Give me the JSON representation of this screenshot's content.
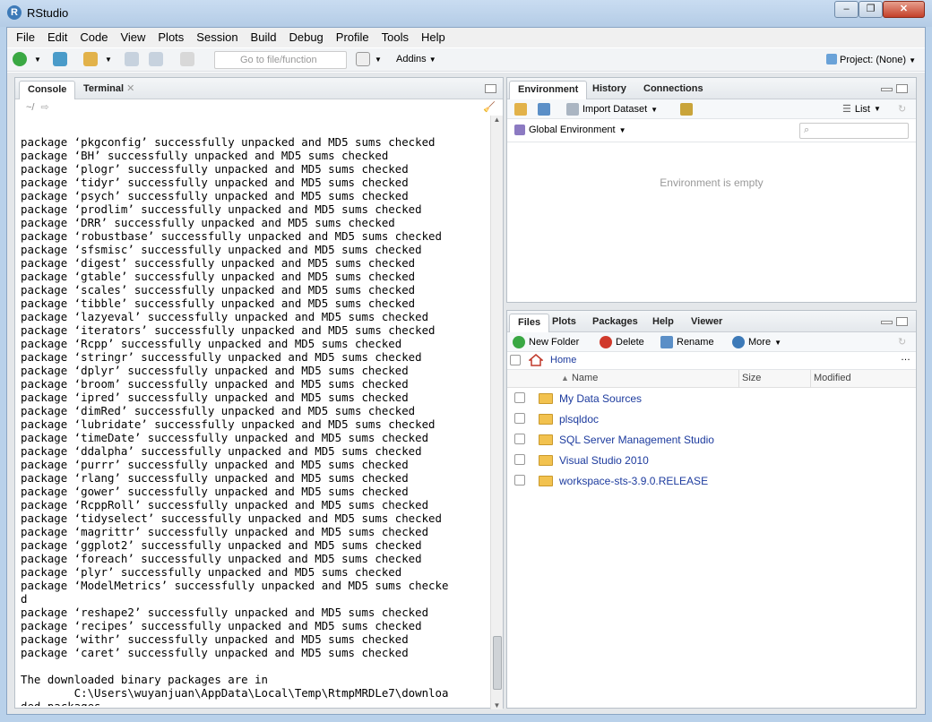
{
  "window": {
    "title": "RStudio"
  },
  "menu": [
    "File",
    "Edit",
    "Code",
    "View",
    "Plots",
    "Session",
    "Build",
    "Debug",
    "Profile",
    "Tools",
    "Help"
  ],
  "toolbar": {
    "goto_placeholder": "Go to file/function",
    "addins_label": "Addins",
    "project_label": "Project: (None)"
  },
  "console_pane": {
    "tabs": [
      "Console",
      "Terminal"
    ],
    "path": "~/",
    "lines": [
      "package ‘pkgconfig’ successfully unpacked and MD5 sums checked",
      "package ‘BH’ successfully unpacked and MD5 sums checked",
      "package ‘plogr’ successfully unpacked and MD5 sums checked",
      "package ‘tidyr’ successfully unpacked and MD5 sums checked",
      "package ‘psych’ successfully unpacked and MD5 sums checked",
      "package ‘prodlim’ successfully unpacked and MD5 sums checked",
      "package ‘DRR’ successfully unpacked and MD5 sums checked",
      "package ‘robustbase’ successfully unpacked and MD5 sums checked",
      "package ‘sfsmisc’ successfully unpacked and MD5 sums checked",
      "package ‘digest’ successfully unpacked and MD5 sums checked",
      "package ‘gtable’ successfully unpacked and MD5 sums checked",
      "package ‘scales’ successfully unpacked and MD5 sums checked",
      "package ‘tibble’ successfully unpacked and MD5 sums checked",
      "package ‘lazyeval’ successfully unpacked and MD5 sums checked",
      "package ‘iterators’ successfully unpacked and MD5 sums checked",
      "package ‘Rcpp’ successfully unpacked and MD5 sums checked",
      "package ‘stringr’ successfully unpacked and MD5 sums checked",
      "package ‘dplyr’ successfully unpacked and MD5 sums checked",
      "package ‘broom’ successfully unpacked and MD5 sums checked",
      "package ‘ipred’ successfully unpacked and MD5 sums checked",
      "package ‘dimRed’ successfully unpacked and MD5 sums checked",
      "package ‘lubridate’ successfully unpacked and MD5 sums checked",
      "package ‘timeDate’ successfully unpacked and MD5 sums checked",
      "package ‘ddalpha’ successfully unpacked and MD5 sums checked",
      "package ‘purrr’ successfully unpacked and MD5 sums checked",
      "package ‘rlang’ successfully unpacked and MD5 sums checked",
      "package ‘gower’ successfully unpacked and MD5 sums checked",
      "package ‘RcppRoll’ successfully unpacked and MD5 sums checked",
      "package ‘tidyselect’ successfully unpacked and MD5 sums checked",
      "package ‘magrittr’ successfully unpacked and MD5 sums checked",
      "package ‘ggplot2’ successfully unpacked and MD5 sums checked",
      "package ‘foreach’ successfully unpacked and MD5 sums checked",
      "package ‘plyr’ successfully unpacked and MD5 sums checked",
      "package ‘ModelMetrics’ successfully unpacked and MD5 sums checke",
      "d",
      "package ‘reshape2’ successfully unpacked and MD5 sums checked",
      "package ‘recipes’ successfully unpacked and MD5 sums checked",
      "package ‘withr’ successfully unpacked and MD5 sums checked",
      "package ‘caret’ successfully unpacked and MD5 sums checked",
      "",
      "The downloaded binary packages are in",
      "        C:\\Users\\wuyanjuan\\AppData\\Local\\Temp\\RtmpMRDLe7\\downloa",
      "ded_packages"
    ],
    "prompt": ">"
  },
  "environment_pane": {
    "tabs": [
      "Environment",
      "History",
      "Connections"
    ],
    "import_label": "Import Dataset",
    "list_label": "List",
    "scope_label": "Global Environment",
    "empty_text": "Environment is empty"
  },
  "files_pane": {
    "tabs": [
      "Files",
      "Plots",
      "Packages",
      "Help",
      "Viewer"
    ],
    "new_folder": "New Folder",
    "delete": "Delete",
    "rename": "Rename",
    "more": "More",
    "breadcrumb": "Home",
    "columns": [
      "Name",
      "Size",
      "Modified"
    ],
    "items": [
      "My Data Sources",
      "plsqldoc",
      "SQL Server Management Studio",
      "Visual Studio 2010",
      "workspace-sts-3.9.0.RELEASE"
    ]
  }
}
